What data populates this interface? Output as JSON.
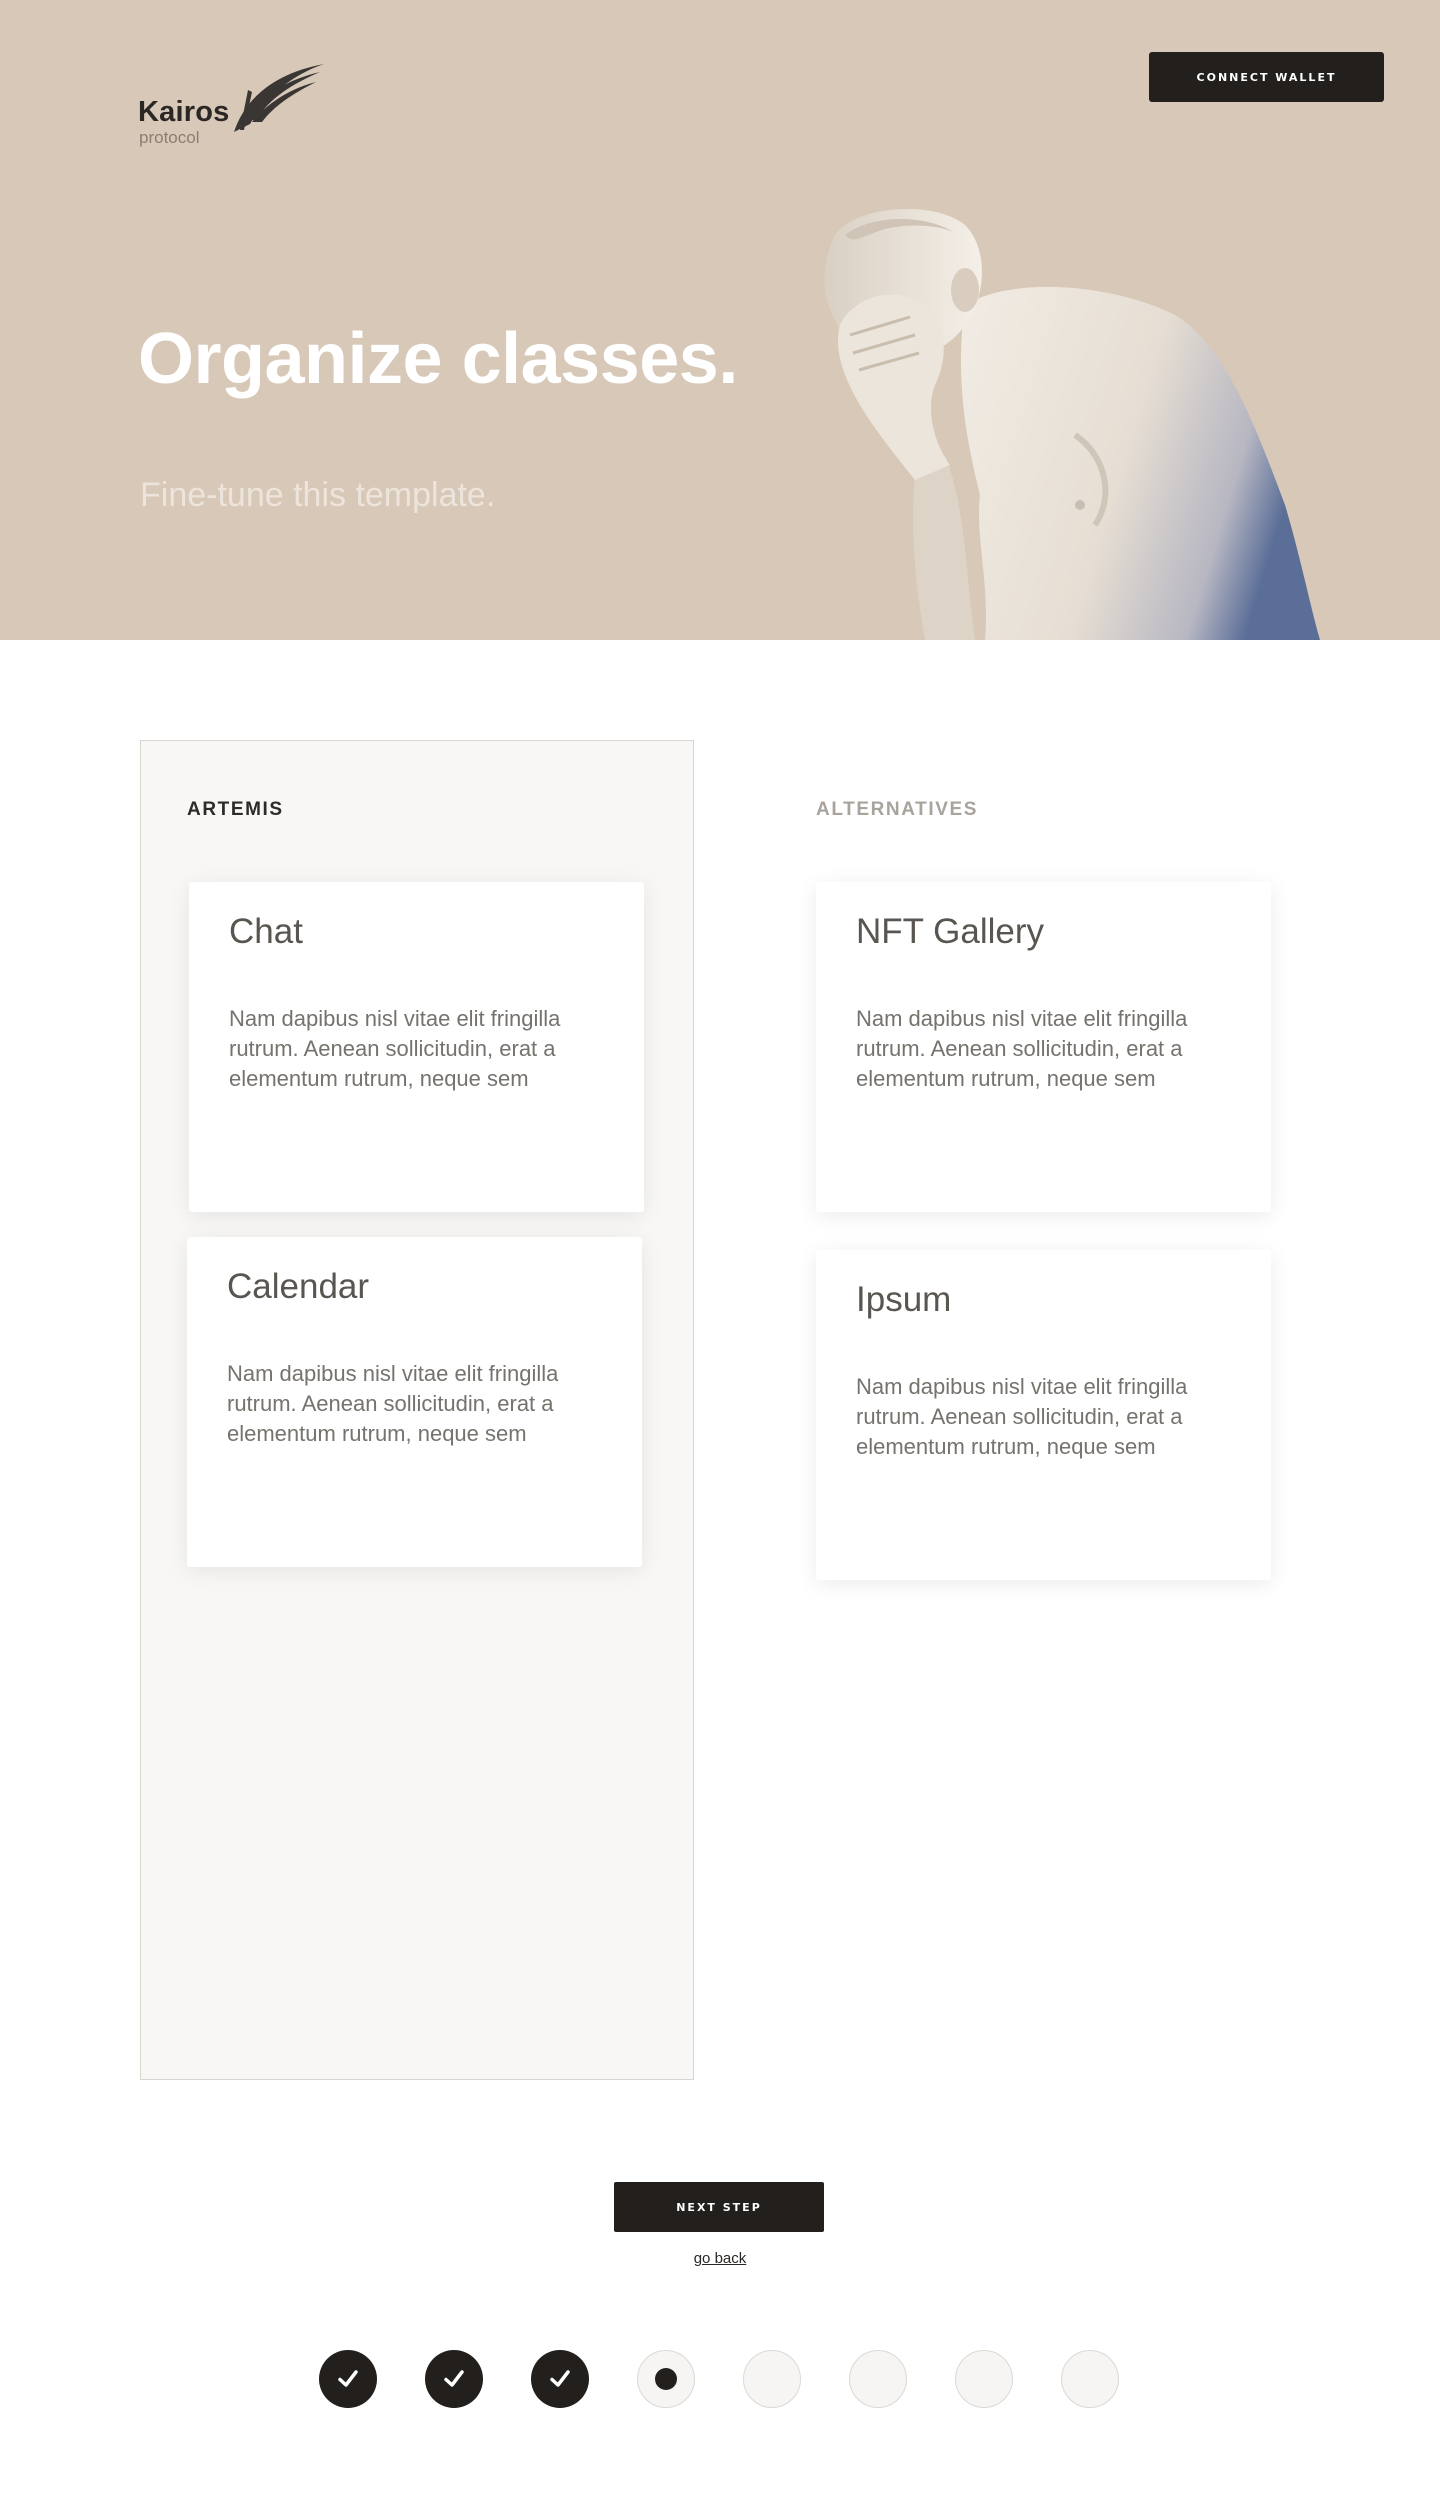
{
  "brand": {
    "name": "Kairos",
    "sub": "protocol"
  },
  "header": {
    "connect_label": "CONNECT WALLET"
  },
  "hero": {
    "title": "Organize classes.",
    "subtitle": "Fine-tune this template."
  },
  "columns": {
    "left": {
      "heading": "ARTEMIS",
      "cards": [
        {
          "title": "Chat",
          "body": "Nam dapibus nisl vitae elit fringilla rutrum. Aenean sollicitudin, erat a elementum rutrum, neque sem"
        },
        {
          "title": "Calendar",
          "body": "Nam dapibus nisl vitae elit fringilla rutrum. Aenean sollicitudin, erat a elementum rutrum, neque sem"
        }
      ]
    },
    "right": {
      "heading": "ALTERNATIVES",
      "cards": [
        {
          "title": "NFT Gallery",
          "body": "Nam dapibus nisl vitae elit fringilla rutrum. Aenean sollicitudin, erat a elementum rutrum, neque sem"
        },
        {
          "title": "Ipsum",
          "body": "Nam dapibus nisl vitae elit fringilla rutrum. Aenean sollicitudin, erat a elementum rutrum, neque sem"
        }
      ]
    }
  },
  "nav": {
    "next_label": "NEXT STEP",
    "back_label": "go back"
  },
  "progress": {
    "total_steps": 8,
    "completed": 3,
    "current": 4
  },
  "colors": {
    "hero_bg": "#d8c8b8",
    "dark": "#221f1c",
    "panel_bg": "#f8f7f5"
  }
}
